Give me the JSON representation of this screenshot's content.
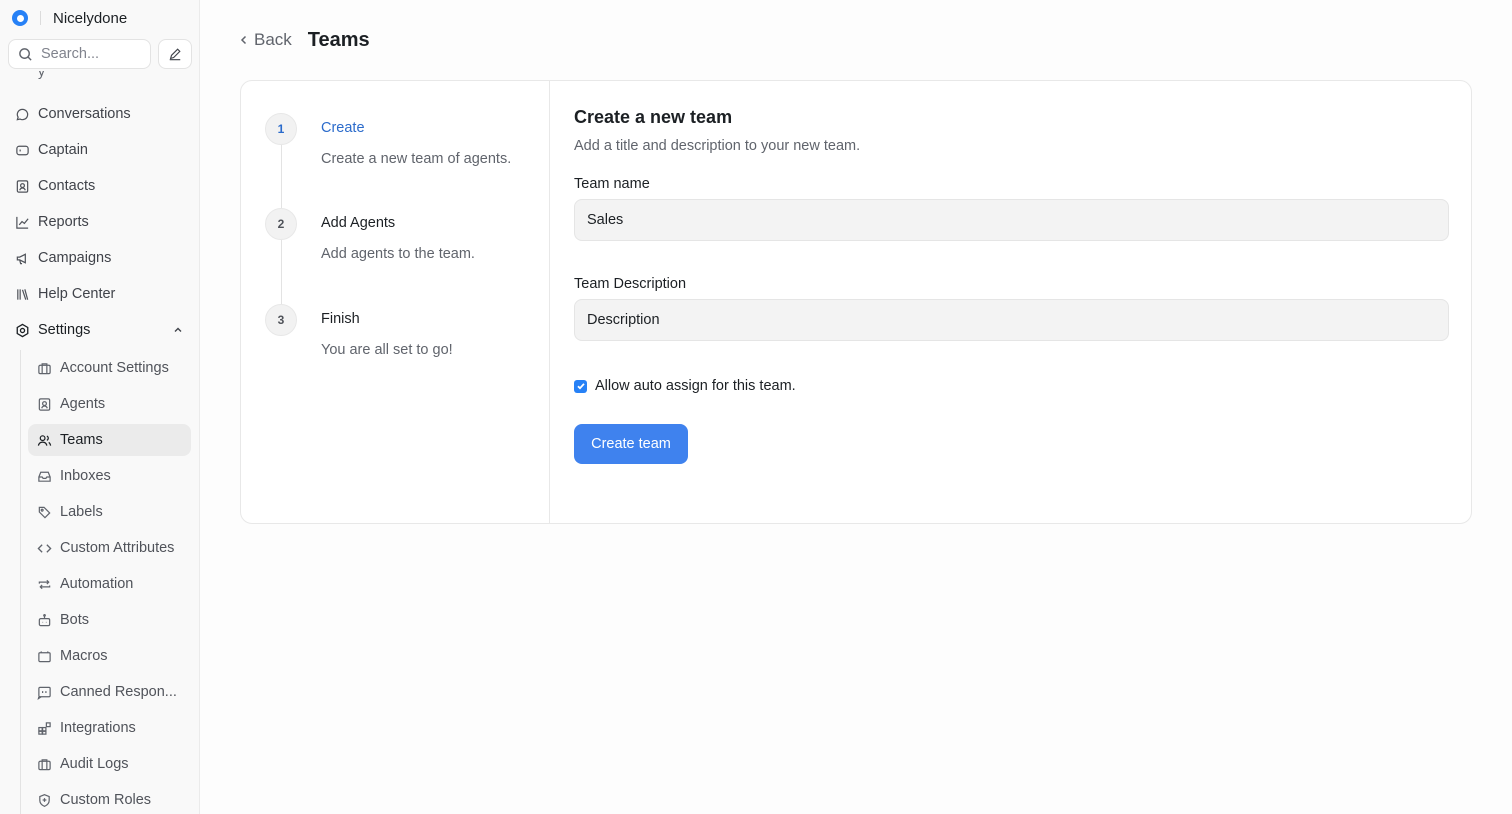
{
  "brand": {
    "name": "Nicelydone"
  },
  "search": {
    "placeholder": "Search..."
  },
  "nav": [
    {
      "label": "Conversations",
      "icon": "chat-bubble-icon"
    },
    {
      "label": "Captain",
      "icon": "captain-icon"
    },
    {
      "label": "Contacts",
      "icon": "contact-card-icon"
    },
    {
      "label": "Reports",
      "icon": "line-chart-icon"
    },
    {
      "label": "Campaigns",
      "icon": "megaphone-icon"
    },
    {
      "label": "Help Center",
      "icon": "library-icon"
    },
    {
      "label": "Settings",
      "icon": "gear-icon"
    }
  ],
  "settings_items": [
    {
      "label": "Account Settings",
      "icon": "briefcase-icon"
    },
    {
      "label": "Agents",
      "icon": "agent-icon"
    },
    {
      "label": "Teams",
      "icon": "people-icon",
      "active": true
    },
    {
      "label": "Inboxes",
      "icon": "inbox-icon"
    },
    {
      "label": "Labels",
      "icon": "tag-icon"
    },
    {
      "label": "Custom Attributes",
      "icon": "code-icon"
    },
    {
      "label": "Automation",
      "icon": "arrows-swap-icon"
    },
    {
      "label": "Bots",
      "icon": "bot-icon"
    },
    {
      "label": "Macros",
      "icon": "folder-icon"
    },
    {
      "label": "Canned Respon...",
      "icon": "quote-icon"
    },
    {
      "label": "Integrations",
      "icon": "grid-plus-icon"
    },
    {
      "label": "Audit Logs",
      "icon": "briefcase-icon"
    },
    {
      "label": "Custom Roles",
      "icon": "shield-icon"
    }
  ],
  "header": {
    "back_label": "Back",
    "title": "Teams"
  },
  "steps": [
    {
      "number": "1",
      "title": "Create",
      "description": "Create a new team of agents.",
      "active": true
    },
    {
      "number": "2",
      "title": "Add Agents",
      "description": "Add agents to the team."
    },
    {
      "number": "3",
      "title": "Finish",
      "description": "You are all set to go!"
    }
  ],
  "form": {
    "title": "Create a new team",
    "subtitle": "Add a title and description to your new team.",
    "name_label": "Team name",
    "name_value": "Sales",
    "description_label": "Team Description",
    "description_value": "Description",
    "auto_assign_label": "Allow auto assign for this team.",
    "auto_assign_checked": true,
    "submit_label": "Create team"
  },
  "colors": {
    "accent": "#3f82ee",
    "active_step": "#2b6bcb"
  }
}
